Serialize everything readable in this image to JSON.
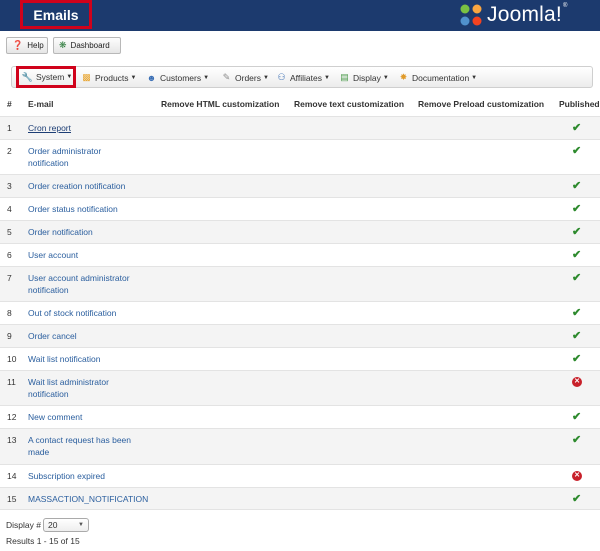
{
  "header": {
    "title": "Emails",
    "logo_text": "Joomla!",
    "logo_reg": "®"
  },
  "toolbar": {
    "help_label": "Help",
    "dashboard_label": "Dashboard"
  },
  "menu": {
    "system": "System",
    "products": "Products",
    "customers": "Customers",
    "orders": "Orders",
    "affiliates": "Affiliates",
    "display": "Display",
    "documentation": "Documentation"
  },
  "columns": {
    "num": "#",
    "email": "E-mail",
    "remove_html": "Remove HTML customization",
    "remove_text": "Remove text customization",
    "remove_preload": "Remove Preload customization",
    "published": "Published"
  },
  "rows": [
    {
      "num": "1",
      "name": "Cron report",
      "published": true
    },
    {
      "num": "2",
      "name": "Order administrator notification",
      "published": true
    },
    {
      "num": "3",
      "name": "Order creation notification",
      "published": true
    },
    {
      "num": "4",
      "name": "Order status notification",
      "published": true
    },
    {
      "num": "5",
      "name": "Order notification",
      "published": true
    },
    {
      "num": "6",
      "name": "User account",
      "published": true
    },
    {
      "num": "7",
      "name": "User account administrator notification",
      "published": true
    },
    {
      "num": "8",
      "name": "Out of stock notification",
      "published": true
    },
    {
      "num": "9",
      "name": "Order cancel",
      "published": true
    },
    {
      "num": "10",
      "name": "Wait list notification",
      "published": true
    },
    {
      "num": "11",
      "name": "Wait list administrator notification",
      "published": false
    },
    {
      "num": "12",
      "name": "New comment",
      "published": true
    },
    {
      "num": "13",
      "name": "A contact request has been made",
      "published": true
    },
    {
      "num": "14",
      "name": "Subscription expired",
      "published": false
    },
    {
      "num": "15",
      "name": "MASSACTION_NOTIFICATION",
      "published": true
    }
  ],
  "footer": {
    "display_label": "Display #",
    "display_value": "20",
    "results": "Results 1 - 15 of 15"
  },
  "colors": {
    "header_bg": "#1c3a6e",
    "highlight": "#d0021b",
    "link": "#2a5e9e",
    "ok": "#2d8a2d",
    "error": "#c8202a"
  }
}
